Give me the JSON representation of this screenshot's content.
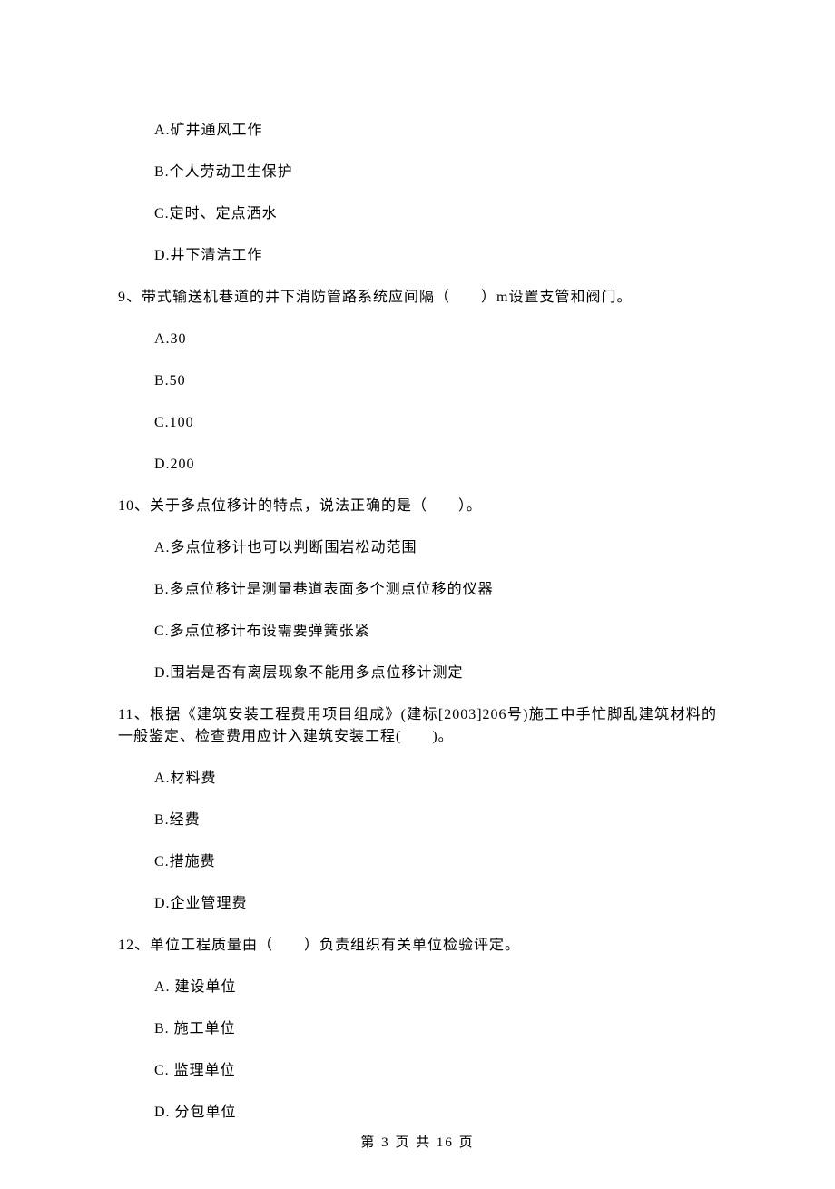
{
  "q8": {
    "options": {
      "A": "A.矿井通风工作",
      "B": "B.个人劳动卫生保护",
      "C": "C.定时、定点洒水",
      "D": "D.井下清洁工作"
    }
  },
  "q9": {
    "stem": "9、带式输送机巷道的井下消防管路系统应间隔（　　）m设置支管和阀门。",
    "options": {
      "A": "A.30",
      "B": "B.50",
      "C": "C.100",
      "D": "D.200"
    }
  },
  "q10": {
    "stem": "10、关于多点位移计的特点，说法正确的是（　　）。",
    "options": {
      "A": "A.多点位移计也可以判断围岩松动范围",
      "B": "B.多点位移计是测量巷道表面多个测点位移的仪器",
      "C": "C.多点位移计布设需要弹簧张紧",
      "D": "D.围岩是否有离层现象不能用多点位移计测定"
    }
  },
  "q11": {
    "stem": "11、根据《建筑安装工程费用项目组成》(建标[2003]206号)施工中手忙脚乱建筑材料的一般鉴定、检查费用应计入建筑安装工程(　　)。",
    "options": {
      "A": "A.材料费",
      "B": "B.经费",
      "C": "C.措施费",
      "D": "D.企业管理费"
    }
  },
  "q12": {
    "stem": "12、单位工程质量由（　　）负责组织有关单位检验评定。",
    "options": {
      "A": "A.  建设单位",
      "B": "B.  施工单位",
      "C": "C.  监理单位",
      "D": "D.  分包单位"
    }
  },
  "footer": "第 3 页 共 16 页"
}
